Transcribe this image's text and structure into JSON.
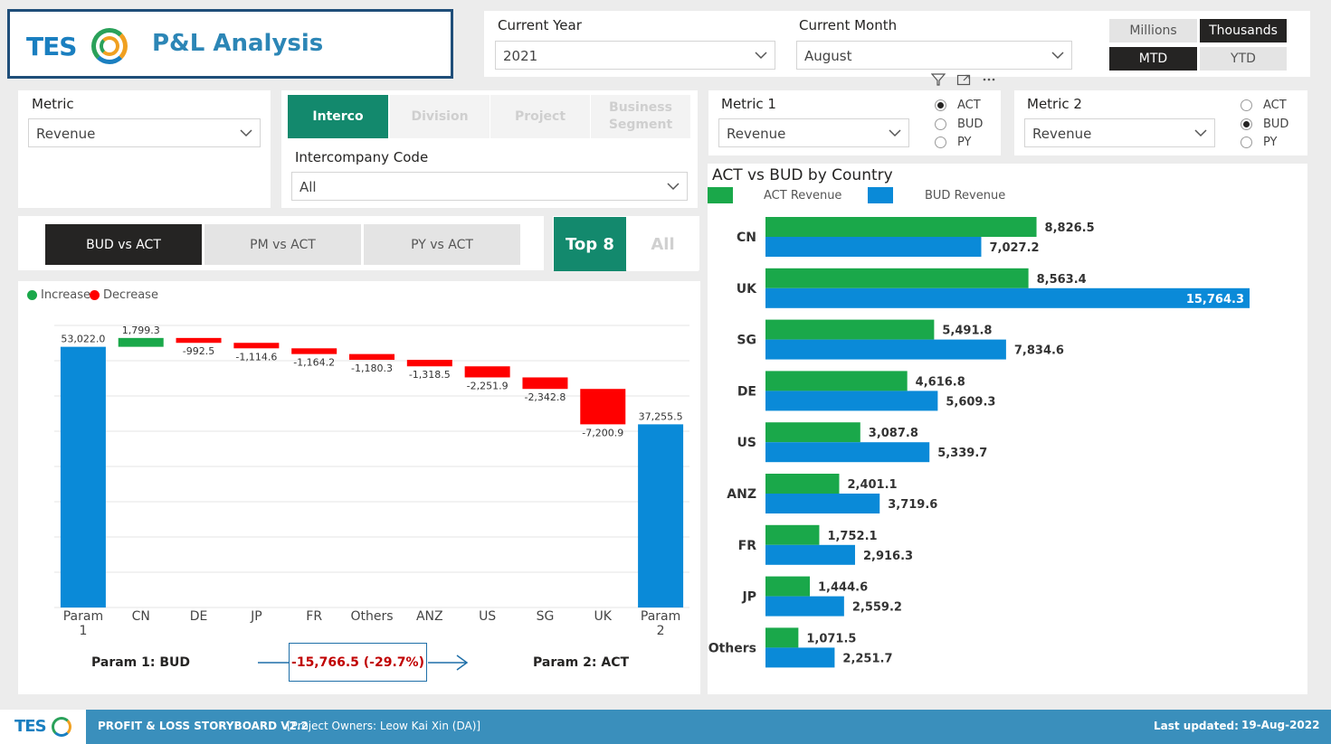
{
  "header": {
    "logo_text": "TES",
    "title": "P&L Analysis"
  },
  "filters": {
    "current_year": {
      "label": "Current Year",
      "value": "2021"
    },
    "current_month": {
      "label": "Current Month",
      "value": "August"
    }
  },
  "unit_toggle": {
    "millions": "Millions",
    "thousands": "Thousands",
    "active": "Thousands"
  },
  "period_toggle": {
    "mtd": "MTD",
    "ytd": "YTD",
    "active": "MTD"
  },
  "visual_header_icons": [
    "filter-icon",
    "focus-mode-icon",
    "more-options-icon"
  ],
  "metric_slicer": {
    "label": "Metric",
    "value": "Revenue"
  },
  "dimension_tabs": {
    "items": [
      "Interco",
      "Division",
      "Project",
      "Business Segment"
    ],
    "active": "Interco"
  },
  "intercompany": {
    "label": "Intercompany Code",
    "value": "All"
  },
  "metric1": {
    "label": "Metric 1",
    "value": "Revenue",
    "options": [
      "ACT",
      "BUD",
      "PY"
    ],
    "selected": "ACT"
  },
  "metric2": {
    "label": "Metric 2",
    "value": "Revenue",
    "options": [
      "ACT",
      "BUD",
      "PY"
    ],
    "selected": "BUD"
  },
  "comparison_tabs": {
    "items": [
      "BUD vs ACT",
      "PM vs ACT",
      "PY vs ACT"
    ],
    "active": "BUD vs ACT"
  },
  "topn_tabs": {
    "top8": "Top 8",
    "all": "All",
    "active": "Top 8"
  },
  "waterfall": {
    "legend": [
      {
        "label": "Increase",
        "color": "#1aa84a"
      },
      {
        "label": "Decrease",
        "color": "#ff0000"
      }
    ],
    "param1_label": "Param 1: BUD",
    "param2_label": "Param 2: ACT",
    "variance": "-15,766.5 (-29.7%)"
  },
  "bar_chart": {
    "title": "ACT vs BUD by Country",
    "legend": [
      {
        "label": "ACT Revenue",
        "color": "#1aa84a"
      },
      {
        "label": "BUD Revenue",
        "color": "#0a8ad8"
      }
    ]
  },
  "chart_data": [
    {
      "type": "bar",
      "subtype": "waterfall",
      "categories": [
        "Param 1",
        "CN",
        "DE",
        "JP",
        "FR",
        "Others",
        "ANZ",
        "US",
        "SG",
        "UK",
        "Param 2"
      ],
      "values": [
        53022.0,
        1799.3,
        -992.5,
        -1114.6,
        -1164.2,
        -1180.3,
        -1318.5,
        -2251.9,
        -2342.8,
        -7200.9,
        37255.5
      ],
      "labels": [
        "53,022.0",
        "1,799.3",
        "-992.5",
        "-1,114.6",
        "-1,164.2",
        "-1,180.3",
        "-1,318.5",
        "-2,251.9",
        "-2,342.8",
        "-7,200.9",
        "37,255.5"
      ],
      "total_color": "#0a8ad8",
      "increase_color": "#1aa84a",
      "decrease_color": "#ff0000",
      "ylim": [
        0,
        57000
      ],
      "grid": true,
      "legend": [
        "Increase",
        "Decrease"
      ]
    },
    {
      "type": "bar",
      "orientation": "horizontal",
      "title": "ACT vs BUD by Country",
      "categories": [
        "CN",
        "UK",
        "SG",
        "DE",
        "US",
        "ANZ",
        "FR",
        "JP",
        "Others"
      ],
      "series": [
        {
          "name": "ACT Revenue",
          "color": "#1aa84a",
          "values": [
            8826.5,
            8563.4,
            5491.8,
            4616.8,
            3087.8,
            2401.1,
            1752.1,
            1444.6,
            1071.5
          ],
          "labels": [
            "8,826.5",
            "8,563.4",
            "5,491.8",
            "4,616.8",
            "3,087.8",
            "2,401.1",
            "1,752.1",
            "1,444.6",
            "1,071.5"
          ]
        },
        {
          "name": "BUD Revenue",
          "color": "#0a8ad8",
          "values": [
            7027.2,
            15764.3,
            7834.6,
            5609.3,
            5339.7,
            3719.6,
            2916.3,
            2559.2,
            2251.7
          ],
          "labels": [
            "7,027.2",
            "15,764.3",
            "7,834.6",
            "5,609.3",
            "5,339.7",
            "3,719.6",
            "2,916.3",
            "2,559.2",
            "2,251.7"
          ]
        }
      ],
      "legend": "top-left"
    }
  ],
  "footer": {
    "logo_text": "TES",
    "title": "PROFIT & LOSS STORYBOARD V2.2",
    "owners": "[Project Owners: Leow Kai Xin (DA)]",
    "updated_label": "Last updated:",
    "updated_date": "19-Aug-2022"
  }
}
